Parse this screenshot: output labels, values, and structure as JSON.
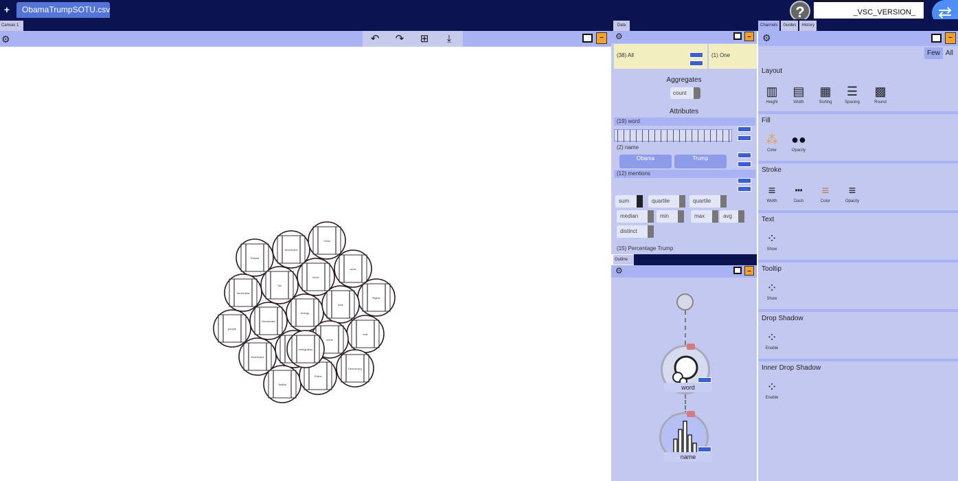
{
  "topbar": {
    "plus_label": "+",
    "file_tab": "ObamaTrumpSOTU.csv",
    "help_label": "?",
    "version": "_VSC_VERSION_"
  },
  "canvas": {
    "tab_label": "Canvas 1",
    "toolbar_icons": [
      "undo-icon",
      "redo-icon",
      "add-selection-icon",
      "download-icon"
    ],
    "bubble_labels": [
      "Russia",
      "Americans",
      "Cuba",
      "word",
      "Venezuela",
      "Tax",
      "terror",
      "Rights",
      "people",
      "Democrats",
      "energy",
      "jobs",
      "vote",
      "Americans",
      "economy",
      "crime",
      "Democracy",
      "Justice",
      "Chiluv",
      "Immigration"
    ]
  },
  "data_panel": {
    "tab_label": "Data",
    "all_label": "(38) All",
    "one_label": "(1) One",
    "aggregates_title": "Aggregates",
    "count_label": "count",
    "attributes_title": "Attributes",
    "attr_word": "(19) word",
    "attr_name": "(2) name",
    "name_values": [
      "Obama",
      "Trump"
    ],
    "attr_mentions": "(12) mentions",
    "agg_options": [
      "sum",
      "quartile",
      "quartile",
      "median",
      "min",
      "max",
      "avg",
      "distinct"
    ],
    "attr_pct": "(15) Percentage Trump"
  },
  "outline_panel": {
    "tab_label": "Outline",
    "node1_label": "word",
    "node2_label": "name"
  },
  "channels_panel": {
    "tabs": [
      "Channels",
      "Guides",
      "History"
    ],
    "few_label": "Few",
    "all_label": "All",
    "layout_title": "Layout",
    "layout_items": [
      "Height",
      "Width",
      "Sorting",
      "Spacing",
      "Round"
    ],
    "fill_title": "Fill",
    "fill_items": [
      "Color",
      "Opacity"
    ],
    "stroke_title": "Stroke",
    "stroke_items": [
      "Width",
      "Dash",
      "Color",
      "Opacity"
    ],
    "text_title": "Text",
    "text_item": "Show",
    "tooltip_title": "Tooltip",
    "tooltip_item": "Show",
    "drop_title": "Drop Shadow",
    "drop_item": "Enable",
    "inner_title": "Inner Drop Shadow",
    "inner_item": "Enable"
  },
  "colors": {
    "topbar": "#0b1350",
    "panel": "#c2c8f0",
    "panel_head": "#a9b3f4",
    "accent": "#5574d8",
    "minimize": "#f2a12a"
  }
}
